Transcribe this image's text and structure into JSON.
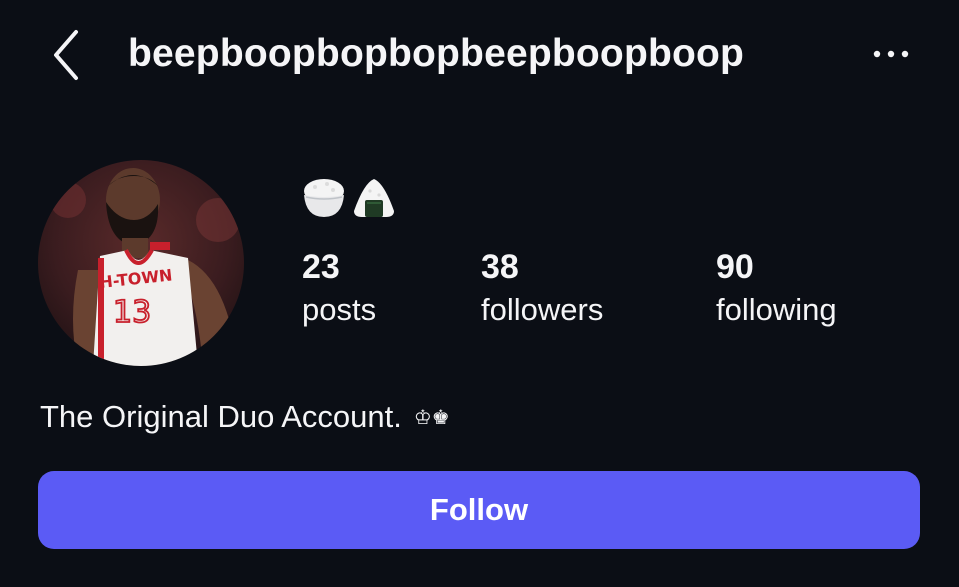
{
  "header": {
    "back_icon": "chevron-left-icon",
    "username": "beepboopbopbopbeepboopboop",
    "more_icon": "more-horizontal-icon"
  },
  "profile": {
    "avatar_icon": "profile-photo-basketball-player",
    "bio_emoji": [
      "rice-bowl-emoji",
      "rice-ball-emoji"
    ],
    "stats": {
      "posts": {
        "count": "23",
        "label": "posts"
      },
      "followers": {
        "count": "38",
        "label": "followers"
      },
      "following": {
        "count": "90",
        "label": "following"
      }
    },
    "bio": {
      "text": "The Original Duo Account.",
      "crowns": "♔♚"
    }
  },
  "actions": {
    "follow_label": "Follow"
  },
  "colors": {
    "background": "#0b0e15",
    "text": "#f5f5f7",
    "follow_button": "#5b5bf5"
  }
}
